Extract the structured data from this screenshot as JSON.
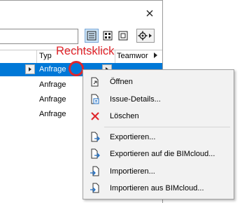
{
  "window": {
    "close_symbol": "×",
    "columns": {
      "type": "Typ",
      "teamwork": "Teamwor"
    },
    "rows": [
      {
        "type": "Anfrage",
        "selected": true
      },
      {
        "type": "Anfrage",
        "selected": false
      },
      {
        "type": "Anfrage",
        "selected": false
      },
      {
        "type": "Anfrage",
        "selected": false
      }
    ],
    "toolbar_icons": [
      "list-view-icon",
      "grid-view-icon",
      "single-view-icon",
      "settings-gear-icon"
    ]
  },
  "annotation": {
    "label": "Rechtsklick",
    "color": "#e0242a"
  },
  "context_menu": {
    "items": [
      {
        "label": "Öffnen",
        "icon": "open-icon"
      },
      {
        "label": "Issue-Details...",
        "icon": "issue-details-icon"
      },
      {
        "label": "Löschen",
        "icon": "delete-icon"
      },
      {
        "label": "Exportieren...",
        "icon": "export-icon"
      },
      {
        "label": "Exportieren auf die BIMcloud...",
        "icon": "export-bimcloud-icon"
      },
      {
        "label": "Importieren...",
        "icon": "import-icon"
      },
      {
        "label": "Importieren aus BIMcloud...",
        "icon": "import-bimcloud-icon"
      }
    ]
  },
  "colors": {
    "selection": "#0078d7",
    "accent_blue": "#1f6fc5",
    "delete_red": "#e0242a"
  }
}
